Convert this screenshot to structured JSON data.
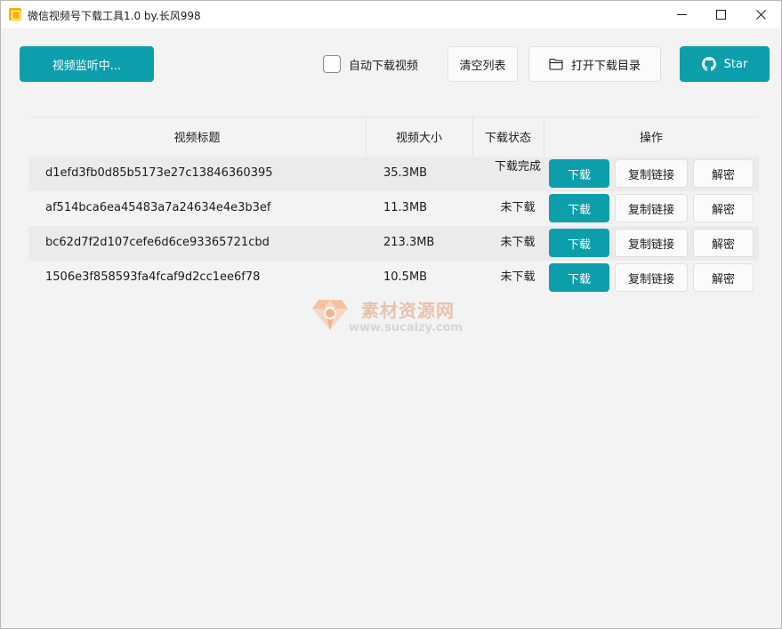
{
  "window": {
    "title": "微信视频号下载工具1.0 by.长风998"
  },
  "toolbar": {
    "monitor_label": "视频监听中...",
    "auto_download_label": "自动下载视频",
    "auto_download_checked": false,
    "clear_label": "清空列表",
    "open_dir_label": "打开下载目录",
    "star_label": "Star"
  },
  "table": {
    "headers": [
      "视频标题",
      "视频大小",
      "下载状态",
      "操作"
    ],
    "rows": [
      {
        "title": "d1efd3fb0d85b5173e27c13846360395",
        "size": "35.3MB",
        "status": "下载完成"
      },
      {
        "title": "af514bca6ea45483a7a24634e4e3b3ef",
        "size": "11.3MB",
        "status": "未下载"
      },
      {
        "title": "bc62d7f2d107cefe6d6ce93365721cbd",
        "size": "213.3MB",
        "status": "未下载"
      },
      {
        "title": "1506e3f858593fa4fcaf9d2cc1ee6f78",
        "size": "10.5MB",
        "status": "未下载"
      }
    ],
    "actions": {
      "download": "下载",
      "copy_link": "复制链接",
      "decrypt": "解密"
    }
  },
  "watermark": {
    "name_cn": "素材资源网",
    "url": "www.sucaizy.com"
  },
  "colors": {
    "accent": "#0d9eab",
    "background": "#f3f3f3",
    "row_alt": "#ebebeb"
  },
  "icons": {
    "app": "wechat-channels-app-icon",
    "folder": "folder-icon",
    "github": "github-icon",
    "minimize": "minimize-icon",
    "maximize": "maximize-icon",
    "close": "close-icon"
  }
}
